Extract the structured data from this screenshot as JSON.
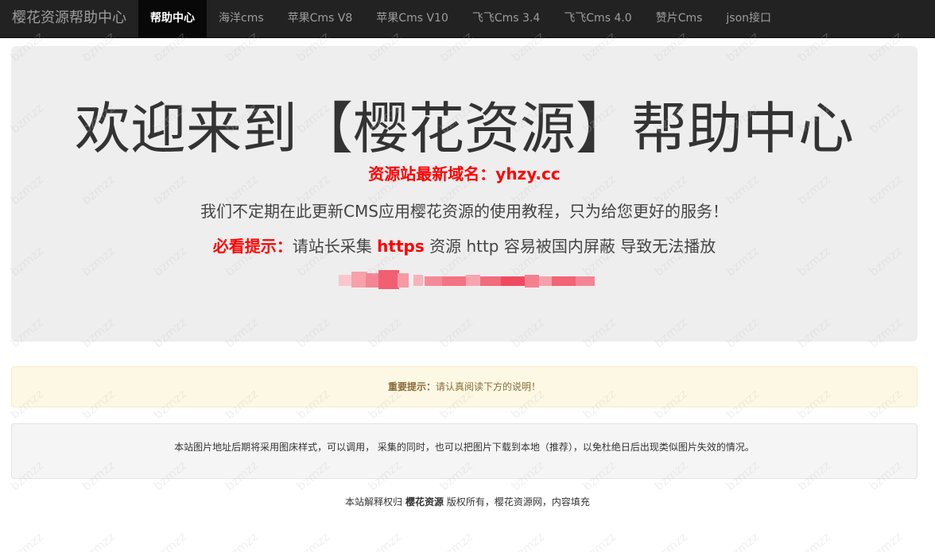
{
  "navbar": {
    "brand": "樱花资源帮助中心",
    "items": [
      {
        "label": "帮助中心",
        "active": true
      },
      {
        "label": "海洋cms",
        "active": false
      },
      {
        "label": "苹果Cms V8",
        "active": false
      },
      {
        "label": "苹果Cms V10",
        "active": false
      },
      {
        "label": "飞飞Cms 3.4",
        "active": false
      },
      {
        "label": "飞飞Cms 4.0",
        "active": false
      },
      {
        "label": "赞片Cms",
        "active": false
      },
      {
        "label": "json接口",
        "active": false
      }
    ]
  },
  "jumbotron": {
    "title": "欢迎来到【樱花资源】帮助中心",
    "domain_notice": "资源站最新域名：yhzy.cc",
    "description": "我们不定期在此更新CMS应用樱花资源的使用教程，只为给您更好的服务！",
    "tip_label": "必看提示：",
    "tip_part1": "请站长采集 ",
    "tip_https": "https",
    "tip_part2": " 资源 http 容易被国内屏蔽 导致无法播放"
  },
  "alert": {
    "label": "重要提示：",
    "text": "请认真阅读下方的说明！"
  },
  "well": {
    "text": "本站图片地址后期将采用图床样式，可以调用， 采集的同时，也可以把图片下载到本地（推荐），以免杜绝日后出现类似图片失效的情况。"
  },
  "footer": {
    "prefix": "本站解释权归 ",
    "brand": "樱花资源",
    "suffix": " 版权所有，樱花资源网，内容填充"
  },
  "watermark": {
    "text": "bzmzz"
  },
  "colors": {
    "navbar_bg": "#222222",
    "jumbotron_bg": "#eeeeee",
    "highlight_red": "#ff0000",
    "alert_bg": "#fcf8e3",
    "alert_text": "#8a6d3b",
    "well_bg": "#f5f5f5"
  }
}
